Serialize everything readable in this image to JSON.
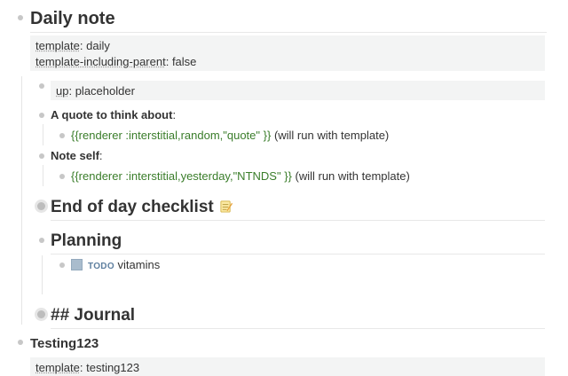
{
  "daily_note": {
    "title": "Daily note",
    "properties": [
      {
        "key": "template",
        "value": "daily"
      },
      {
        "key": "template-including-parent",
        "value": "false"
      }
    ],
    "up_property": {
      "key": "up",
      "value": "placeholder"
    },
    "quote_label": "A quote to think about",
    "quote_renderer": "{{renderer :interstitial,random,\"quote\" }}",
    "quote_suffix": "(will run with template)",
    "note_self_label": "Note self",
    "note_self_renderer": "{{renderer :interstitial,yesterday,\"NTNDS\" }}",
    "note_self_suffix": "(will run with template)",
    "checklist_heading": "End of day checklist",
    "checklist_icon": "memo-icon",
    "planning_heading": "Planning",
    "todo_marker": "TODO",
    "todo_text": "vitamins",
    "journal_heading": "## Journal"
  },
  "testing": {
    "title": "Testing123",
    "property": {
      "key": "template",
      "value": "testing123"
    }
  },
  "colors": {
    "renderer_green": "#3a7d2a",
    "todo_blue": "#5e7f9f",
    "property_bg": "#f3f4f4"
  }
}
